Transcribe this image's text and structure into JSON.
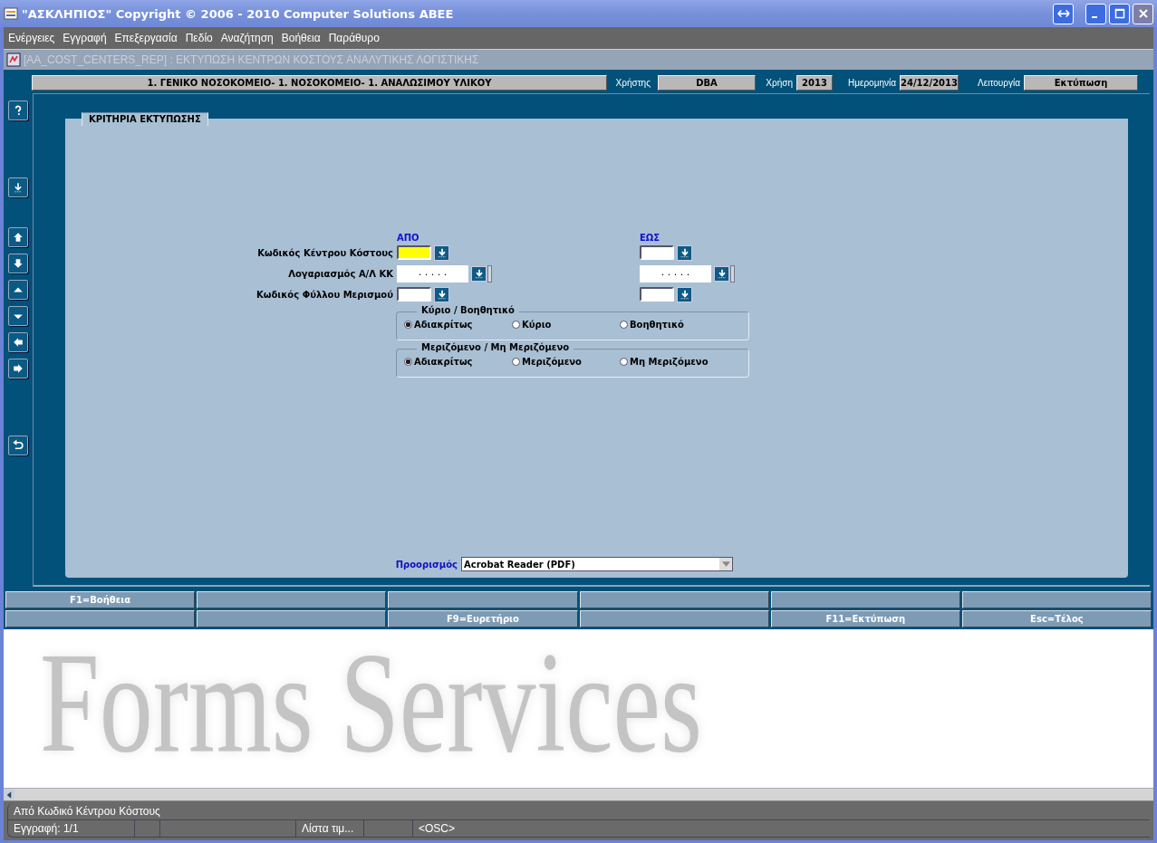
{
  "window": {
    "title": "\"ΑΣΚΛΗΠΙΟΣ\" Copyright © 2006 - 2010 Computer Solutions ΑΒΕΕ"
  },
  "menu": [
    "Ενέργειες",
    "Εγγραφή",
    "Επεξεργασία",
    "Πεδίο",
    "Αναζήτηση",
    "Βοήθεια",
    "Παράθυρο"
  ],
  "form_title": "[AA_COST_CENTERS_REP]  :  ΕΚΤΥΠΩΣΗ ΚΕΝΤΡΩΝ ΚΟΣΤΟΥΣ ΑΝΑΛΥΤΙΚΗΣ ΛΟΓΙΣΤΙΚΗΣ",
  "header": {
    "organization": "1. ΓΕΝΙΚΟ ΝΟΣΟΚΟΜΕΙΟ- 1. ΝΟΣΟΚΟΜΕΙΟ- 1. ΑΝΑΛΩΣΙΜΟΥ ΥΛΙΚΟΥ",
    "fields": [
      {
        "label": "Χρήστης",
        "value": "DBA"
      },
      {
        "label": "Χρήση",
        "value": "2013"
      },
      {
        "label": "Ημερομηνία",
        "value": "24/12/2013"
      },
      {
        "label": "Λειτουργία",
        "value": "Εκτύπωση"
      }
    ]
  },
  "toolbar_groups": [
    [
      {
        "kind": "help"
      }
    ],
    [
      {
        "kind": "list"
      }
    ],
    [
      {
        "kind": "up"
      },
      {
        "kind": "down"
      },
      {
        "kind": "first"
      },
      {
        "kind": "last"
      },
      {
        "kind": "left"
      },
      {
        "kind": "right"
      }
    ],
    [
      {
        "kind": "undo"
      }
    ]
  ],
  "tab": {
    "label": "ΚΡΙΤΗΡΙΑ ΕΚΤΥΠΩΣΗΣ"
  },
  "criteria": {
    "from_heading": "ΑΠΟ",
    "to_heading": "ΕΩΣ",
    "rows": [
      {
        "label": "Κωδικός Κέντρου Κόστους",
        "kind": "code",
        "from": {
          "focused": true
        },
        "to": {
          "focused": false
        }
      },
      {
        "label": "Λογαριασμός Α/Λ ΚΚ",
        "kind": "account",
        "from": {
          "value": ". . . . .",
          "focused": false
        },
        "to": {
          "value": ". . . . .",
          "focused": false
        }
      },
      {
        "label": "Κωδικός Φύλλου Μερισμού",
        "kind": "code",
        "from": {
          "focused": false
        },
        "to": {
          "focused": false
        }
      }
    ],
    "radio_groups": [
      {
        "title": "Κύριο / Βοηθητικό",
        "options": [
          {
            "label": "Αδιακρίτως",
            "selected": true
          },
          {
            "label": "Κύριο",
            "selected": false
          },
          {
            "label": "Βοηθητικό",
            "selected": false
          }
        ]
      },
      {
        "title": "Μεριζόμενο / Μη Μεριζόμενο",
        "options": [
          {
            "label": "Αδιακρίτως",
            "selected": true
          },
          {
            "label": "Μεριζόμενο",
            "selected": false
          },
          {
            "label": "Μη Μεριζόμενο",
            "selected": false
          }
        ]
      }
    ],
    "destination": {
      "label": "Προορισμός",
      "value": "Acrobat Reader (PDF)"
    }
  },
  "function_keys": [
    {
      "kind": "key",
      "label": "F1=Βοήθεια"
    },
    {
      "kind": "blank"
    },
    {
      "kind": "blank"
    },
    {
      "kind": "blank"
    },
    {
      "kind": "blank"
    },
    {
      "kind": "blank"
    },
    {
      "kind": "blank"
    },
    {
      "kind": "blank"
    },
    {
      "kind": "key",
      "label": "F9=Ευρετήριο"
    },
    {
      "kind": "blank"
    },
    {
      "kind": "key",
      "label": "F11=Εκτύπωση"
    },
    {
      "kind": "key",
      "label": "Esc=Τέλος"
    }
  ],
  "background_logo": "Forms Services",
  "status_bar": {
    "message": "Από Κωδικό Κέντρου Κόστους",
    "record": "Εγγραφή: 1/1",
    "list_hint": "Λίστα τιμ...",
    "mode": "<OSC>"
  }
}
